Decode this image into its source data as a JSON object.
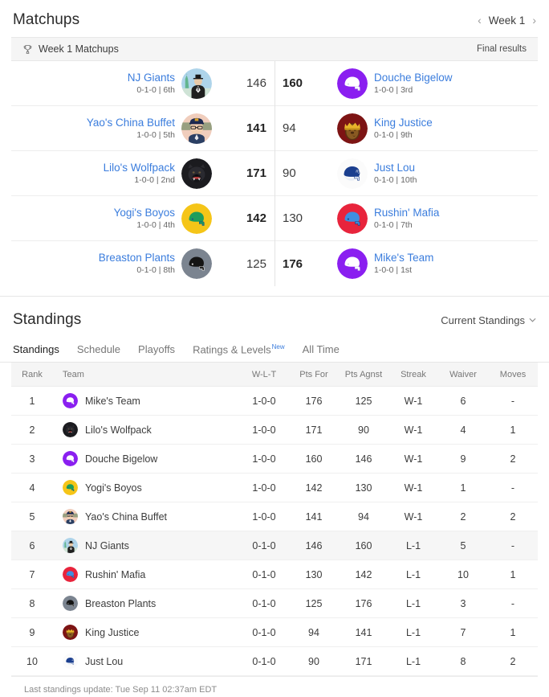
{
  "matchups": {
    "title": "Matchups",
    "week_nav": {
      "prev": "‹",
      "label": "Week 1",
      "next": "›"
    },
    "subbar": {
      "icon": "trophy-icon",
      "label": "Week 1 Matchups",
      "status": "Final results"
    },
    "rows": [
      {
        "left": {
          "name": "NJ Giants",
          "record": "0-1-0 | 6th",
          "score": "146",
          "winner": false,
          "avatar": "statue-liberty-man-avatar"
        },
        "right": {
          "name": "Douche Bigelow",
          "record": "1-0-0 | 3rd",
          "score": "160",
          "winner": true,
          "avatar": "purple-helmet-avatar"
        }
      },
      {
        "left": {
          "name": "Yao's China Buffet",
          "record": "1-0-0 | 5th",
          "score": "141",
          "winner": true,
          "avatar": "cap-glasses-man-avatar"
        },
        "right": {
          "name": "King Justice",
          "record": "0-1-0 | 9th",
          "score": "94",
          "winner": false,
          "avatar": "crown-king-avatar"
        }
      },
      {
        "left": {
          "name": "Lilo's Wolfpack",
          "record": "1-0-0 | 2nd",
          "score": "171",
          "winner": true,
          "avatar": "black-wolf-avatar"
        },
        "right": {
          "name": "Just Lou",
          "record": "0-1-0 | 10th",
          "score": "90",
          "winner": false,
          "avatar": "giants-helmet-avatar"
        }
      },
      {
        "left": {
          "name": "Yogi's Boyos",
          "record": "1-0-0 | 4th",
          "score": "142",
          "winner": true,
          "avatar": "gold-green-helmet-avatar"
        },
        "right": {
          "name": "Rushin' Mafia",
          "record": "0-1-0 | 7th",
          "score": "130",
          "winner": false,
          "avatar": "red-blue-helmet-avatar"
        }
      },
      {
        "left": {
          "name": "Breaston Plants",
          "record": "0-1-0 | 8th",
          "score": "125",
          "winner": false,
          "avatar": "gray-black-helmet-avatar"
        },
        "right": {
          "name": "Mike's Team",
          "record": "1-0-0 | 1st",
          "score": "176",
          "winner": true,
          "avatar": "purple-helmet-avatar"
        }
      }
    ]
  },
  "standings": {
    "title": "Standings",
    "dropdown": {
      "label": "Current Standings",
      "caret": "⌄"
    },
    "tabs": [
      {
        "label": "Standings",
        "active": true,
        "badge": ""
      },
      {
        "label": "Schedule",
        "active": false,
        "badge": ""
      },
      {
        "label": "Playoffs",
        "active": false,
        "badge": ""
      },
      {
        "label": "Ratings & Levels",
        "active": false,
        "badge": "New"
      },
      {
        "label": "All Time",
        "active": false,
        "badge": ""
      }
    ],
    "columns": [
      "Rank",
      "Team",
      "W-L-T",
      "Pts For",
      "Pts Agnst",
      "Streak",
      "Waiver",
      "Moves"
    ],
    "rows": [
      {
        "rank": "1",
        "team": "Mike's Team",
        "avatar": "purple-helmet-avatar",
        "wlt": "1-0-0",
        "pts_for": "176",
        "pts_agnst": "125",
        "streak": "W-1",
        "waiver": "6",
        "moves": "-",
        "highlight": false
      },
      {
        "rank": "2",
        "team": "Lilo's Wolfpack",
        "avatar": "black-wolf-avatar",
        "wlt": "1-0-0",
        "pts_for": "171",
        "pts_agnst": "90",
        "streak": "W-1",
        "waiver": "4",
        "moves": "1",
        "highlight": false
      },
      {
        "rank": "3",
        "team": "Douche Bigelow",
        "avatar": "purple-helmet-avatar",
        "wlt": "1-0-0",
        "pts_for": "160",
        "pts_agnst": "146",
        "streak": "W-1",
        "waiver": "9",
        "moves": "2",
        "highlight": false
      },
      {
        "rank": "4",
        "team": "Yogi's Boyos",
        "avatar": "gold-green-helmet-avatar",
        "wlt": "1-0-0",
        "pts_for": "142",
        "pts_agnst": "130",
        "streak": "W-1",
        "waiver": "1",
        "moves": "-",
        "highlight": false
      },
      {
        "rank": "5",
        "team": "Yao's China Buffet",
        "avatar": "cap-glasses-man-avatar",
        "wlt": "1-0-0",
        "pts_for": "141",
        "pts_agnst": "94",
        "streak": "W-1",
        "waiver": "2",
        "moves": "2",
        "highlight": false
      },
      {
        "rank": "6",
        "team": "NJ Giants",
        "avatar": "statue-liberty-man-avatar",
        "wlt": "0-1-0",
        "pts_for": "146",
        "pts_agnst": "160",
        "streak": "L-1",
        "waiver": "5",
        "moves": "-",
        "highlight": true
      },
      {
        "rank": "7",
        "team": "Rushin' Mafia",
        "avatar": "red-blue-helmet-avatar",
        "wlt": "0-1-0",
        "pts_for": "130",
        "pts_agnst": "142",
        "streak": "L-1",
        "waiver": "10",
        "moves": "1",
        "highlight": false
      },
      {
        "rank": "8",
        "team": "Breaston Plants",
        "avatar": "gray-black-helmet-avatar",
        "wlt": "0-1-0",
        "pts_for": "125",
        "pts_agnst": "176",
        "streak": "L-1",
        "waiver": "3",
        "moves": "-",
        "highlight": false
      },
      {
        "rank": "9",
        "team": "King Justice",
        "avatar": "crown-king-avatar",
        "wlt": "0-1-0",
        "pts_for": "94",
        "pts_agnst": "141",
        "streak": "L-1",
        "waiver": "7",
        "moves": "1",
        "highlight": false
      },
      {
        "rank": "10",
        "team": "Just Lou",
        "avatar": "giants-helmet-avatar",
        "wlt": "0-1-0",
        "pts_for": "90",
        "pts_agnst": "171",
        "streak": "L-1",
        "waiver": "8",
        "moves": "2",
        "highlight": false
      }
    ],
    "footnote": "Last standings update: Tue Sep 11 02:37am EDT"
  },
  "colors": {
    "link": "#3b7ddd",
    "purple": "#8a1ff0",
    "gold": "#f5c518",
    "red": "#e8243c",
    "gray": "#7b8490",
    "new_badge": "#3b7ddd"
  }
}
